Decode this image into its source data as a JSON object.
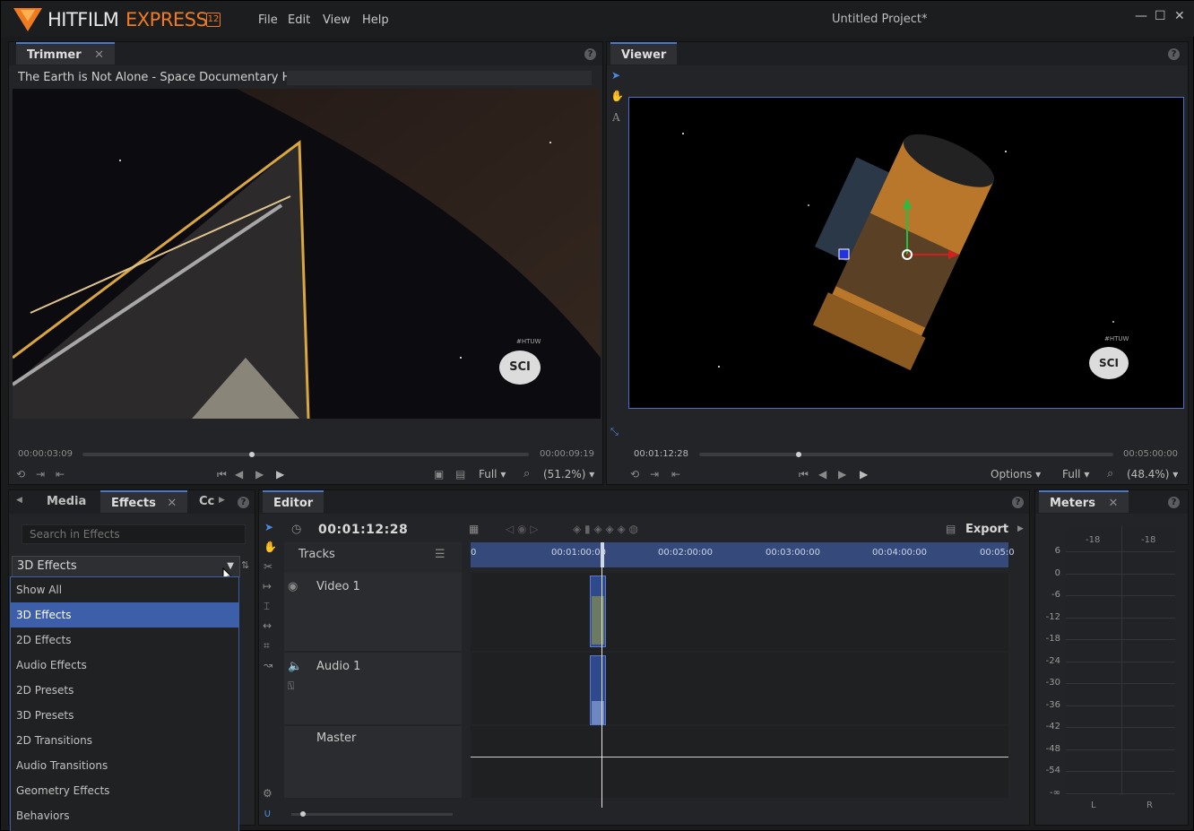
{
  "app": {
    "brand_a": "HITFILM",
    "brand_b": "EXPRESS",
    "version": "12",
    "project_title": "Untitled Project*"
  },
  "menu": {
    "items": [
      "File",
      "Edit",
      "View",
      "Help"
    ]
  },
  "window_controls": {
    "minimize": "—",
    "maximize": "☐",
    "close": "✕"
  },
  "trimmer": {
    "tab_label": "Trimmer",
    "close": "✕",
    "clip_title": "The Earth is Not Alone - Space Documentary HD",
    "watermark_small": "#HTUW",
    "watermark_logo": "SCI",
    "time_current": "00:00:03:09",
    "time_end": "00:00:09:19",
    "progress": 0.38,
    "quality": "Full",
    "zoom": "(51.2%)"
  },
  "viewer": {
    "tab_label": "Viewer",
    "watermark_small": "#HTUW",
    "watermark_logo": "SCI",
    "time_current": "00:01:12:28",
    "time_end": "00:05:00:00",
    "progress": 0.24,
    "options": "Options",
    "quality": "Full",
    "zoom": "(48.4%)"
  },
  "left_panel": {
    "tabs": [
      {
        "label": "Media"
      },
      {
        "label": "Effects",
        "close": "✕"
      },
      {
        "label": "Cc"
      }
    ],
    "search_placeholder": "Search in Effects",
    "selected": "3D Effects",
    "options": [
      "Show All",
      "3D Effects",
      "2D Effects",
      "Audio Effects",
      "2D Presets",
      "3D Presets",
      "2D Transitions",
      "Audio Transitions",
      "Geometry Effects",
      "Behaviors"
    ]
  },
  "editor": {
    "tab_label": "Editor",
    "timecode": "00:01:12:28",
    "export": "Export",
    "tracks_label": "Tracks",
    "ruler": [
      "0",
      "00:01:00:00",
      "00:02:00:00",
      "00:03:00:00",
      "00:04:00:00",
      "00:05:0"
    ],
    "tracks": [
      {
        "name": "Video 1"
      },
      {
        "name": "Audio 1"
      },
      {
        "name": "Master"
      }
    ]
  },
  "meters": {
    "tab_label": "Meters",
    "close": "✕",
    "top_left": "-18",
    "top_right": "-18",
    "scale": [
      "6",
      "0",
      "-6",
      "-12",
      "-18",
      "-24",
      "-30",
      "-36",
      "-42",
      "-48",
      "-54",
      "-∞"
    ],
    "channels": [
      "L",
      "R"
    ]
  },
  "help": "?"
}
